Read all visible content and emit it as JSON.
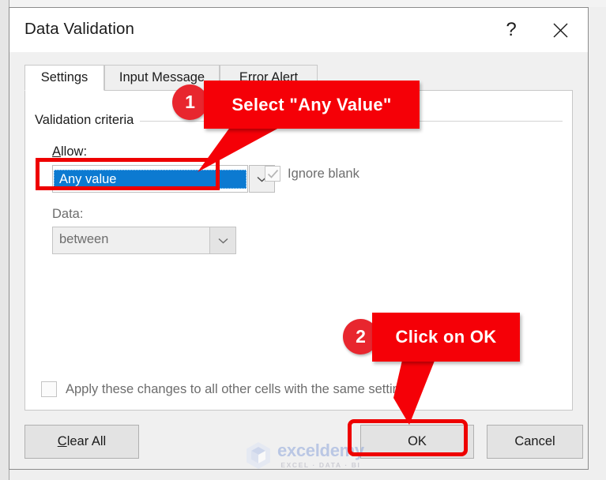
{
  "window": {
    "title": "Data Validation",
    "help_icon": "question-mark-icon",
    "close_icon": "close-icon"
  },
  "tabs": [
    {
      "label": "Settings",
      "active": true
    },
    {
      "label": "Input Message",
      "active": false
    },
    {
      "label": "Error Alert",
      "active": false
    }
  ],
  "settings": {
    "group_label": "Validation criteria",
    "allow_label_prefix": "A",
    "allow_label_rest": "llow:",
    "allow_value": "Any value",
    "allow_dropdown_icon": "chevron-down-icon",
    "ignore_blank_label": "Ignore blank",
    "ignore_blank_checked": true,
    "ignore_blank_enabled": false,
    "data_label": "Data:",
    "data_value": "between",
    "data_dropdown_icon": "chevron-down-icon",
    "data_enabled": false,
    "apply_all_label": "Apply these changes to all other cells with the same settings",
    "apply_all_checked": false,
    "apply_all_enabled": false
  },
  "buttons": {
    "clear_all_prefix": "C",
    "clear_all_rest": "lear All",
    "ok": "OK",
    "cancel": "Cancel"
  },
  "annotations": [
    {
      "number": "1",
      "text": "Select \"Any Value\""
    },
    {
      "number": "2",
      "text": "Click on OK"
    }
  ],
  "watermark": {
    "name": "exceldemy",
    "tagline": "EXCEL · DATA · BI",
    "logo_icon": "hexagon-cube-logo-icon"
  },
  "colors": {
    "callout_red": "#f50007",
    "badge_red": "#e8262e",
    "highlight_ring_red": "#ee0000",
    "selection_blue": "#0c7ad1",
    "dialog_bg": "#f0f0f0",
    "panel_bg": "#ffffff",
    "disabled_text": "#6d6d6d"
  }
}
